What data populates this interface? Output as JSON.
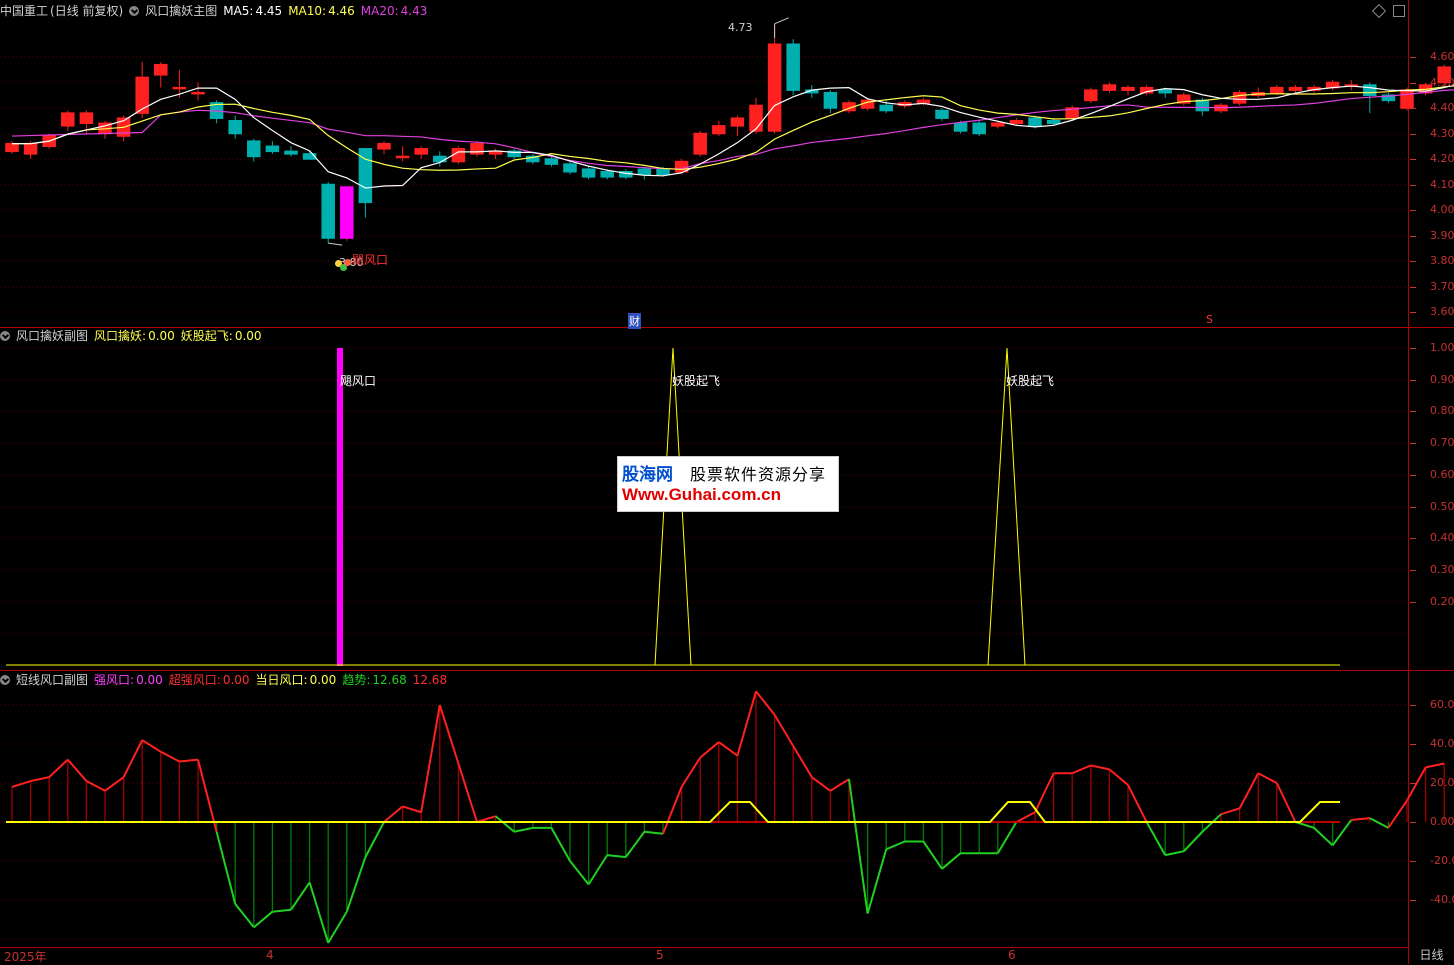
{
  "main_pane": {
    "stock": "中国重工",
    "period": "(日线 前复权)",
    "indicator": "风口擒妖主图",
    "ma5_label": "MA5:",
    "ma5_value": "4.45",
    "ma10_label": "MA10:",
    "ma10_value": "4.46",
    "ma20_label": "MA20:",
    "ma20_value": "4.43",
    "high_marker": "4.73",
    "low_marker": "3.80",
    "signal_label": "飓风口",
    "cai_marker": "财",
    "s_marker": "S",
    "axis": [
      "4.60",
      "4.50",
      "4.40",
      "4.30",
      "4.20",
      "4.10",
      "4.00",
      "3.90",
      "3.80",
      "3.70",
      "3.60"
    ]
  },
  "sub_pane1": {
    "indicator": "风口擒妖副图",
    "l1_label": "风口擒妖:",
    "l1_value": "0.00",
    "l2_label": "妖股起飞:",
    "l2_value": "0.00",
    "signal1": "飓风口",
    "signal2": "妖股起飞",
    "signal3": "妖股起飞",
    "axis": [
      "1.00",
      "0.90",
      "0.80",
      "0.70",
      "0.60",
      "0.50",
      "0.40",
      "0.30",
      "0.20"
    ]
  },
  "sub_pane2": {
    "indicator": "短线风口副图",
    "l1_label": "强风口:",
    "l1_value": "0.00",
    "l2_label": "超强风口:",
    "l2_value": "0.00",
    "l3_label": "当日风口:",
    "l3_value": "0.00",
    "l4_label": "趋势:",
    "l4_value": "12.68",
    "l5_value": "12.68",
    "axis": [
      "60.00",
      "40.00",
      "20.00",
      "0.00",
      "-20.00",
      "-40.00"
    ]
  },
  "dates": {
    "d1": "2025年",
    "d2": "4",
    "d3": "5",
    "d4": "6"
  },
  "period_btn": "日线",
  "watermark": {
    "brand": "股海网",
    "slogan": "股票软件资源分享",
    "url": "Www.Guhai.com.cn"
  },
  "colors": {
    "up": "#ff2020",
    "down": "#00b0b0",
    "ma5": "#ffffff",
    "ma10": "#ffff50",
    "ma20": "#e040e0",
    "grid": "#b00000",
    "magenta": "#ff00ff",
    "yellow": "#ffff00",
    "green": "#20d020"
  }
}
